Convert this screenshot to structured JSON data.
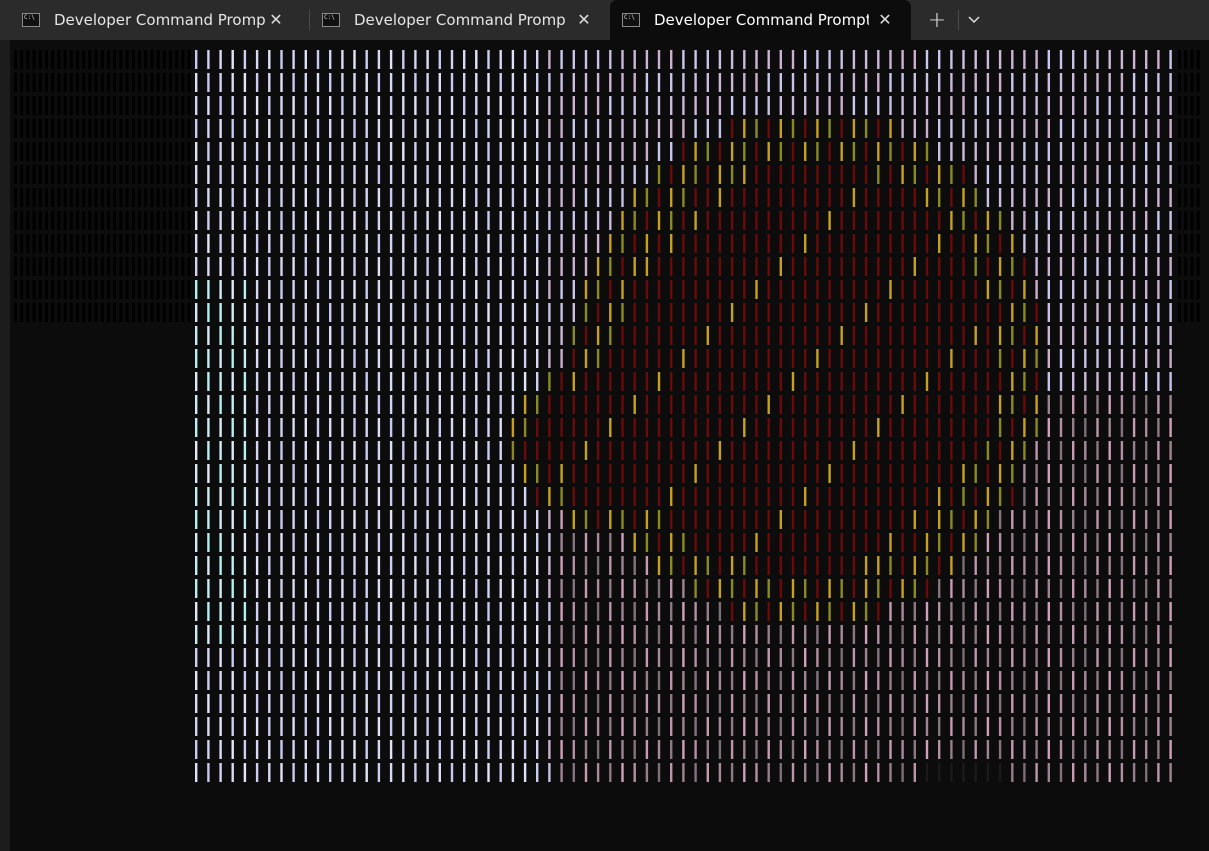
{
  "window": {
    "tabs": [
      {
        "label": "Developer Command Prompt f",
        "active": false,
        "icon": "terminal-icon"
      },
      {
        "label": "Developer Command Prompt f",
        "active": false,
        "icon": "terminal-icon"
      },
      {
        "label": "Developer Command Prompt",
        "active": true,
        "icon": "terminal-icon"
      }
    ],
    "new_tab_symbol": "+",
    "close_symbol": "✕",
    "icon_glyph": "C:\\"
  },
  "terminal": {
    "background": "#0c0c0c",
    "ascii_art_colors": {
      "sky_light": "#c8c8f0",
      "sky_pale": "#e8e8f8",
      "cyan_tint": "#b0f0f0",
      "pink_tint": "#d0a0b8",
      "red_dark": "#6a0a0a",
      "yellow": "#c8a020",
      "olive": "#8a8a20",
      "gray_dark": "#5a5a5a"
    }
  }
}
